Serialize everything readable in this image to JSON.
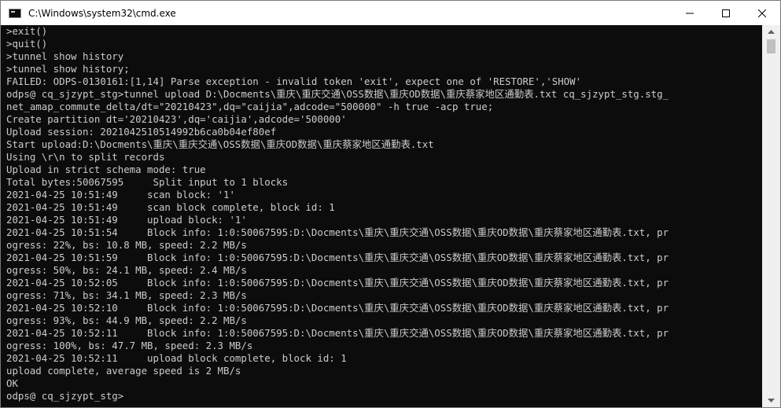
{
  "window": {
    "title": "C:\\Windows\\system32\\cmd.exe",
    "controls": [
      "minimize",
      "maximize",
      "close"
    ]
  },
  "console": {
    "lines": [
      ">exit()",
      ">quit()",
      ">tunnel show history",
      ">tunnel show history;",
      "FAILED: ODPS-0130161:[1,14] Parse exception - invalid token 'exit', expect one of 'RESTORE','SHOW'",
      "odps@ cq_sjzypt_stg>tunnel upload D:\\Docments\\重庆\\重庆交通\\OSS数据\\重庆OD数据\\重庆蔡家地区通勤表.txt cq_sjzypt_stg.stg_",
      "net_amap_commute_delta/dt=\"20210423\",dq=\"caijia\",adcode=\"500000\" -h true -acp true;",
      "Create partition dt='20210423',dq='caijia',adcode='500000'",
      "Upload session: 2021042510514992b6ca0b04ef80ef",
      "Start upload:D:\\Docments\\重庆\\重庆交通\\OSS数据\\重庆OD数据\\重庆蔡家地区通勤表.txt",
      "Using \\r\\n to split records",
      "Upload in strict schema mode: true",
      "Total bytes:50067595     Split input to 1 blocks",
      "2021-04-25 10:51:49     scan block: '1'",
      "2021-04-25 10:51:49     scan block complete, block id: 1",
      "2021-04-25 10:51:49     upload block: '1'",
      "2021-04-25 10:51:54     Block info: 1:0:50067595:D:\\Docments\\重庆\\重庆交通\\OSS数据\\重庆OD数据\\重庆蔡家地区通勤表.txt, pr",
      "ogress: 22%, bs: 10.8 MB, speed: 2.2 MB/s",
      "2021-04-25 10:51:59     Block info: 1:0:50067595:D:\\Docments\\重庆\\重庆交通\\OSS数据\\重庆OD数据\\重庆蔡家地区通勤表.txt, pr",
      "ogress: 50%, bs: 24.1 MB, speed: 2.4 MB/s",
      "2021-04-25 10:52:05     Block info: 1:0:50067595:D:\\Docments\\重庆\\重庆交通\\OSS数据\\重庆OD数据\\重庆蔡家地区通勤表.txt, pr",
      "ogress: 71%, bs: 34.1 MB, speed: 2.3 MB/s",
      "2021-04-25 10:52:10     Block info: 1:0:50067595:D:\\Docments\\重庆\\重庆交通\\OSS数据\\重庆OD数据\\重庆蔡家地区通勤表.txt, pr",
      "ogress: 93%, bs: 44.9 MB, speed: 2.2 MB/s",
      "2021-04-25 10:52:11     Block info: 1:0:50067595:D:\\Docments\\重庆\\重庆交通\\OSS数据\\重庆OD数据\\重庆蔡家地区通勤表.txt, pr",
      "ogress: 100%, bs: 47.7 MB, speed: 2.3 MB/s",
      "2021-04-25 10:52:11     upload block complete, block id: 1",
      "upload complete, average speed is 2 MB/s",
      "OK",
      "odps@ cq_sjzypt_stg>"
    ]
  },
  "colors": {
    "background": "#0c0c0c",
    "text": "#cccccc",
    "titlebar": "#ffffff"
  }
}
